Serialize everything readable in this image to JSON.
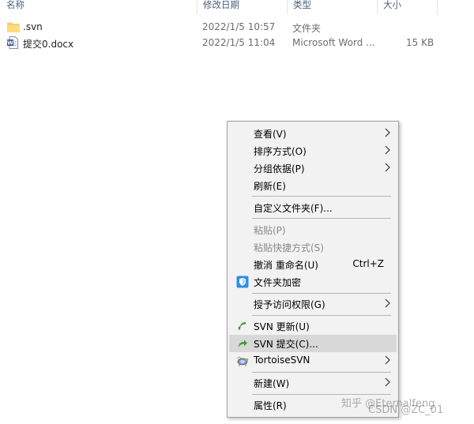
{
  "columns": {
    "name": "名称",
    "date": "修改日期",
    "type": "类型",
    "size": "大小"
  },
  "files": [
    {
      "name": ".svn",
      "date": "2022/1/5 10:57",
      "type": "文件夹",
      "size": "",
      "icon": "folder-icon"
    },
    {
      "name": "提交0.docx",
      "date": "2022/1/5 11:04",
      "type": "Microsoft Word ...",
      "size": "15 KB",
      "icon": "word-document-icon"
    }
  ],
  "menu": {
    "view": "查看(V)",
    "sort": "排序方式(O)",
    "group": "分组依据(P)",
    "refresh": "刷新(E)",
    "customize": "自定义文件夹(F)...",
    "paste": "粘贴(P)",
    "paste_shortcut": "粘贴快捷方式(S)",
    "undo_rename": "撤消 重命名(U)",
    "undo_shortcut": "Ctrl+Z",
    "encrypt": "文件夹加密",
    "grant_access": "授予访问权限(G)",
    "svn_update": "SVN 更新(U)",
    "svn_commit": "SVN 提交(C)...",
    "tortoise": "TortoiseSVN",
    "new": "新建(W)",
    "properties": "属性(R)"
  },
  "watermark": {
    "zhihu": "知乎 @Eternalfeng",
    "csdn": "CSDN @ZC_01"
  },
  "colors": {
    "menu_bg": "#f2f2f2",
    "highlight": "#d8d8d8",
    "svn_green": "#3a9a3a",
    "shield_blue": "#2f8ee6"
  }
}
